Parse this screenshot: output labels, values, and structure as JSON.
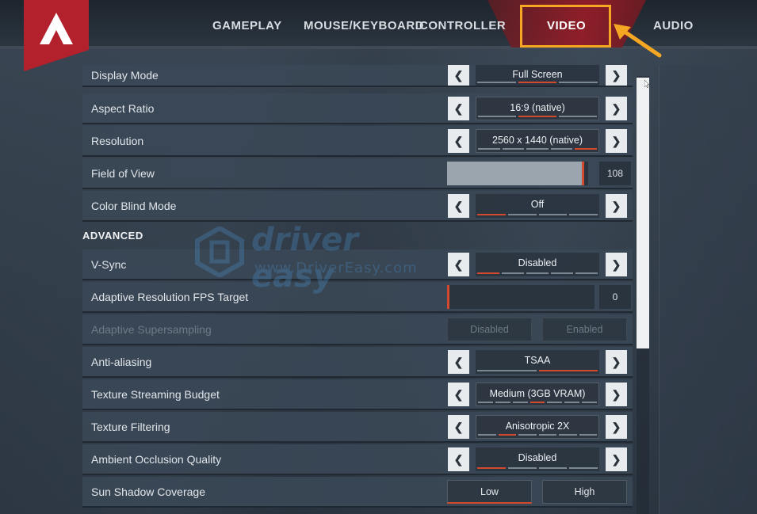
{
  "nav": {
    "tabs": [
      {
        "label": "GAMEPLAY"
      },
      {
        "label": "MOUSE/KEYBOARD"
      },
      {
        "label": "CONTROLLER"
      },
      {
        "label": "VIDEO"
      },
      {
        "label": "AUDIO"
      }
    ],
    "active_tab": "VIDEO"
  },
  "settings": {
    "display_mode": {
      "label": "Display Mode",
      "value": "Full Screen",
      "tick_count": 3,
      "active_tick": 1
    },
    "aspect_ratio": {
      "label": "Aspect Ratio",
      "value": "16:9 (native)",
      "tick_count": 3,
      "active_tick": 1
    },
    "resolution": {
      "label": "Resolution",
      "value": "2560 x 1440 (native)",
      "tick_count": 5,
      "active_tick": 4
    },
    "field_of_view": {
      "label": "Field of View",
      "value": "108",
      "fill_fraction": 0.97
    },
    "color_blind_mode": {
      "label": "Color Blind Mode",
      "value": "Off",
      "tick_count": 4,
      "active_tick": 0
    }
  },
  "advanced": {
    "section_title": "ADVANCED",
    "vsync": {
      "label": "V-Sync",
      "value": "Disabled",
      "tick_count": 5,
      "active_tick": 0
    },
    "adaptive_fps": {
      "label": "Adaptive Resolution FPS Target",
      "value": "0",
      "fill_fraction": 0.0
    },
    "adaptive_supersampling": {
      "label": "Adaptive Supersampling",
      "option_a": "Disabled",
      "option_b": "Enabled"
    },
    "anti_aliasing": {
      "label": "Anti-aliasing",
      "value": "TSAA",
      "tick_count": 2,
      "active_tick": 1
    },
    "texture_streaming": {
      "label": "Texture Streaming Budget",
      "value": "Medium (3GB VRAM)",
      "tick_count": 7,
      "active_tick": 3
    },
    "texture_filtering": {
      "label": "Texture Filtering",
      "value": "Anisotropic 2X",
      "tick_count": 6,
      "active_tick": 1
    },
    "ambient_occlusion": {
      "label": "Ambient Occlusion Quality",
      "value": "Disabled",
      "tick_count": 4,
      "active_tick": 0
    },
    "sun_shadow": {
      "label": "Sun Shadow Coverage",
      "option_a": "Low",
      "option_b": "High"
    }
  },
  "watermark": {
    "title": "driver easy",
    "subtitle": "www.DriverEasy.com"
  },
  "colors": {
    "accent_red": "#b3212d",
    "highlight_orange": "#f5a623",
    "tick_active": "#d24a2e"
  },
  "icons": [
    "apex-logo-icon",
    "chevron-left-icon",
    "chevron-right-icon",
    "arrow-pointer-icon",
    "driver-easy-logo-icon"
  ]
}
